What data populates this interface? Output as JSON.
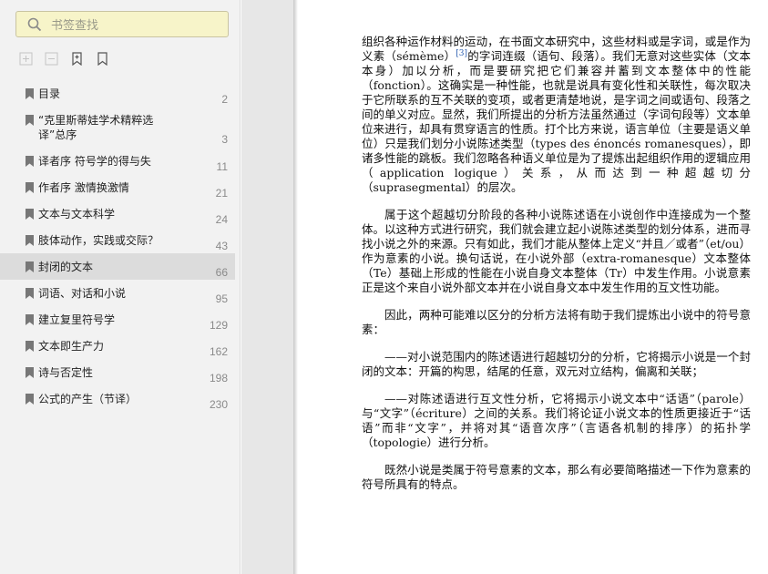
{
  "search": {
    "placeholder": "书签查找"
  },
  "toc": {
    "items": [
      {
        "label": "目录",
        "page": "2"
      },
      {
        "label": "“克里斯蒂娃学术精粹选译”总序",
        "page": "3"
      },
      {
        "label": "译者序 符号学的得与失",
        "page": "11"
      },
      {
        "label": "作者序 激情换激情",
        "page": "21"
      },
      {
        "label": "文本与文本科学",
        "page": "24"
      },
      {
        "label": "肢体动作，实践或交际？",
        "page": "43"
      },
      {
        "label": "封闭的文本",
        "page": "66"
      },
      {
        "label": "词语、对话和小说",
        "page": "95"
      },
      {
        "label": "建立复里符号学",
        "page": "129"
      },
      {
        "label": "文本即生产力",
        "page": "162"
      },
      {
        "label": "诗与否定性",
        "page": "198"
      },
      {
        "label": "公式的产生（节译）",
        "page": "230"
      }
    ],
    "selected_index": 6
  },
  "doc": {
    "p1_a": "组织各种运作材料的运动，在书面文本研究中，这些材料或是字词，或是作为义素（sémème）",
    "p1_note": "[3]",
    "p1_b": "的字词连缀（语句、段落）。我们无意对这些实体（文本本身）加以分析，而是要研究把它们兼容并蓄到文本整体中的性能（fonction）。这确实是一种性能，也就是说具有变化性和关联性，每次取决于它所联系的互不关联的变项，或者更清楚地说，是字词之间或语句、段落之间的单义对应。显然，我们所提出的分析方法虽然通过（字词句段等）文本单位来进行，却具有贯穿语言的性质。打个比方来说，语言单位（主要是语义单位）只是我们划分小说陈述类型（types des énoncés romanesques），即诸多性能的跳板。我们忽略各种语义单位是为了提炼出起组织作用的逻辑应用（application logique）关系，从而达到一种超越切分（suprasegmental）的层次。",
    "p2": "属于这个超越切分阶段的各种小说陈述语在小说创作中连接成为一个整体。以这种方式进行研究，我们就会建立起小说陈述类型的划分体系，进而寻找小说之外的来源。只有如此，我们才能从整体上定义“并且／或者”（et/ou）作为意素的小说。换句话说，在小说外部（extra-romanesque）文本整体（Te）基础上形成的性能在小说自身文本整体（Tr）中发生作用。小说意素正是这个来自小说外部文本并在小说自身文本中发生作用的互文性功能。",
    "p3": "因此，两种可能难以区分的分析方法将有助于我们提炼出小说中的符号意素：",
    "p4": "——对小说范围内的陈述语进行超越切分的分析，它将揭示小说是一个封闭的文本：开篇的构思，结尾的任意，双元对立结构，偏离和关联；",
    "p5": "——对陈述语进行互文性分析，它将揭示小说文本中“话语”（parole）与“文字”（écriture）之间的关系。我们将论证小说文本的性质更接近于“话语”而非“文字”，并将对其“语音次序”（言语各机制的排序）的拓扑学（topologie）进行分析。",
    "p6": "既然小说是类属于符号意素的文本，那么有必要简略描述一下作为意素的符号所具有的特点。"
  }
}
